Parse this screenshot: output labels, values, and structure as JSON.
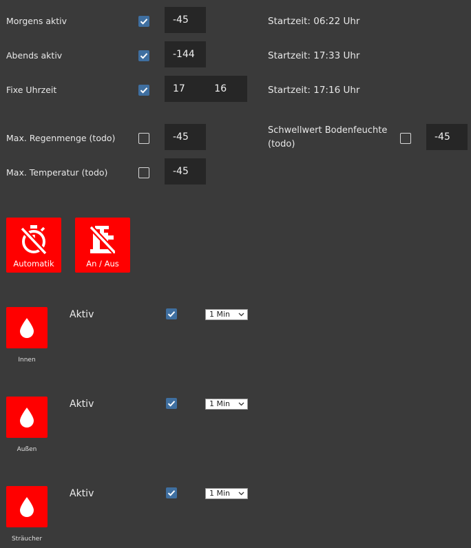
{
  "settings": {
    "morning": {
      "label": "Morgens aktiv",
      "checked": true,
      "value": "-45",
      "start": "Startzeit: 06:22 Uhr"
    },
    "evening": {
      "label": "Abends aktiv",
      "checked": true,
      "value": "-144",
      "start": "Startzeit: 17:33 Uhr"
    },
    "fixed": {
      "label": "Fixe Uhrzeit",
      "checked": true,
      "hour": "17",
      "minute": "16",
      "start": "Startzeit: 17:16 Uhr"
    },
    "rain": {
      "label": "Max. Regenmenge (todo)",
      "checked": false,
      "value": "-45"
    },
    "temp": {
      "label": "Max. Temperatur (todo)",
      "checked": false,
      "value": "-45"
    },
    "moisture": {
      "label": "Schwellwert Bodenfeuchte (todo)",
      "checked": false,
      "value": "-45"
    }
  },
  "buttons": {
    "automatic": {
      "label": "Automatik",
      "icon": "timer-off-icon"
    },
    "onoff": {
      "label": "An / Aus",
      "icon": "faucet-off-icon"
    }
  },
  "zones": [
    {
      "name": "Innen",
      "aktiv_label": "Aktiv",
      "checked": true,
      "duration": "1 Min",
      "icon": "water-drop-icon"
    },
    {
      "name": "Außen",
      "aktiv_label": "Aktiv",
      "checked": true,
      "duration": "1 Min",
      "icon": "water-drop-icon"
    },
    {
      "name": "Sträucher",
      "aktiv_label": "Aktiv",
      "checked": true,
      "duration": "1 Min",
      "icon": "water-drop-icon"
    }
  ],
  "colors": {
    "background": "#3a3a3a",
    "accent": "#ff0000",
    "checkbox": "#3f6fa0",
    "input_bg": "#262626"
  }
}
